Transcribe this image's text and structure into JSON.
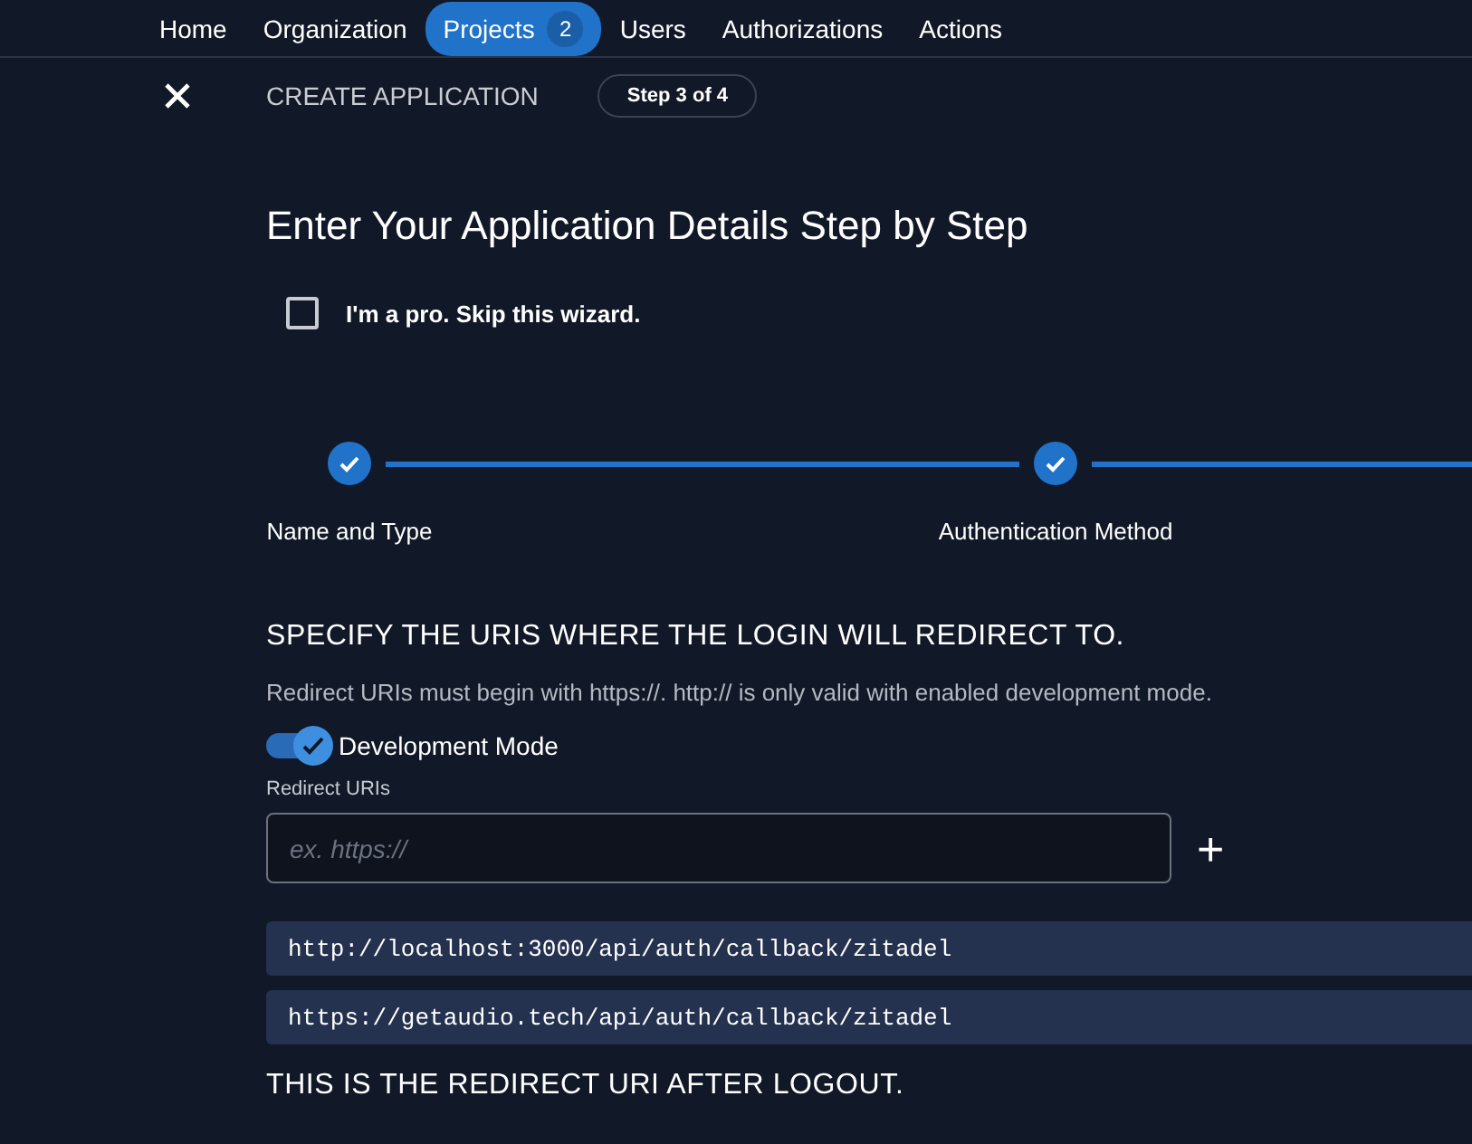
{
  "nav": [
    {
      "label": "Home",
      "selected": false
    },
    {
      "label": "Organization",
      "selected": false
    },
    {
      "label": "Projects",
      "selected": true,
      "count": "2"
    },
    {
      "label": "Users",
      "selected": false
    },
    {
      "label": "Authorizations",
      "selected": false
    },
    {
      "label": "Actions",
      "selected": false
    }
  ],
  "header": {
    "title": "CREATE APPLICATION",
    "step": "Step 3 of 4"
  },
  "heading": "Enter Your Application Details Step by Step",
  "skip_wizard": {
    "label": "I'm a pro. Skip this wizard.",
    "checked": false
  },
  "steps": [
    {
      "label": "Name and Type",
      "completed": true
    },
    {
      "label": "Authentication Method",
      "completed": true
    }
  ],
  "redirect_section": {
    "title": "SPECIFY THE URIS WHERE THE LOGIN WILL REDIRECT TO.",
    "hint": "Redirect URIs must begin with https://. http:// is only valid with enabled development mode.",
    "dev_mode": {
      "label": "Development Mode",
      "on": true
    },
    "field_label": "Redirect URIs",
    "placeholder": "ex. https://",
    "add": "+",
    "uris": [
      "http://localhost:3000/api/auth/callback/zitadel",
      "https://getaudio.tech/api/auth/callback/zitadel"
    ]
  },
  "logout_title": "THIS IS THE REDIRECT URI AFTER LOGOUT."
}
